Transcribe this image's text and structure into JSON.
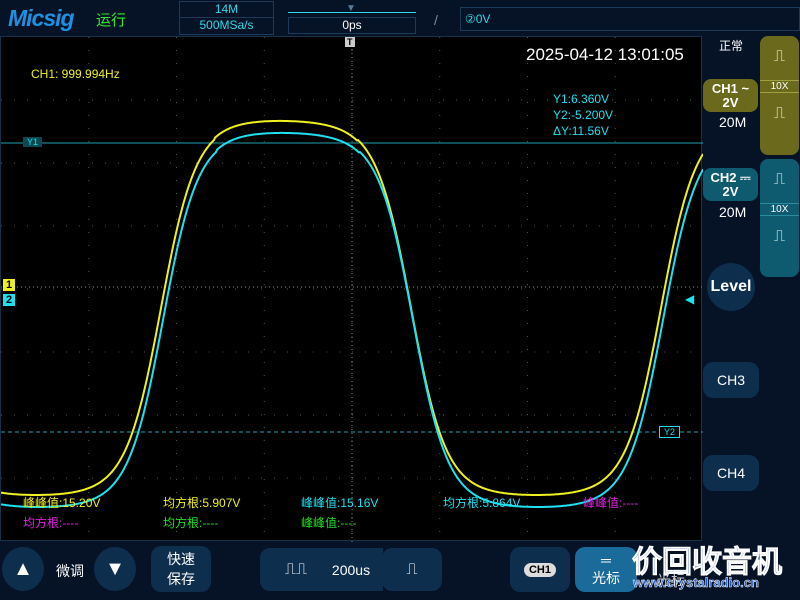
{
  "header": {
    "logo": "Micsig",
    "run_state": "运行",
    "memory_depth": "14M",
    "sample_rate": "500MSa/s",
    "trigger_position": "0ps",
    "trigger_info": "②0V"
  },
  "screen": {
    "timestamp": "2025-04-12 13:01:05",
    "ch1_freq": "CH1: 999.994Hz",
    "cursor": {
      "y1": "Y1:6.360V",
      "y2": "Y2:-5.200V",
      "dy": "ΔY:11.56V",
      "y1_tag": "Y1",
      "y2_tag": "Y2"
    },
    "markers": {
      "ch1": "1",
      "ch2": "2",
      "trigger": "T"
    },
    "measurements": [
      {
        "text": "峰峰值:15.20V",
        "color": "#f0f020"
      },
      {
        "text": "均方根:5.907V",
        "color": "#f0f020"
      },
      {
        "text": "峰峰值:15.16V",
        "color": "#20e0f0"
      },
      {
        "text": "均方根:5.864V",
        "color": "#20e0f0"
      },
      {
        "text": "峰峰值:----",
        "color": "#e020e0"
      },
      {
        "text": "均方根:----",
        "color": "#e020e0"
      },
      {
        "text": "均方根:----",
        "color": "#20e020"
      },
      {
        "text": "峰峰值:----",
        "color": "#20e020"
      }
    ]
  },
  "side": {
    "mode": "正常",
    "ch1": {
      "name": "CH1",
      "coupling": "~",
      "scale": "2V",
      "bw": "20M",
      "probe": "10X",
      "color": "#6b6a1c"
    },
    "ch2": {
      "name": "CH2",
      "coupling": "⎓",
      "scale": "2V",
      "bw": "20M",
      "probe": "10X",
      "color": "#0e5a6e"
    },
    "level": "Level",
    "ch3": "CH3",
    "ch4": "CH4"
  },
  "bottom": {
    "fine_tune": "微调",
    "quick_save": "快速\n保存",
    "timebase": "200us",
    "ch_select": "CH1",
    "cursor_label": "光标",
    "cursor_label2": "光标",
    "watermark": "价回收音机",
    "watermark_url": "www.crystalradio.cn"
  },
  "colors": {
    "ch1": "#f0f020",
    "ch2": "#20e0f0"
  }
}
